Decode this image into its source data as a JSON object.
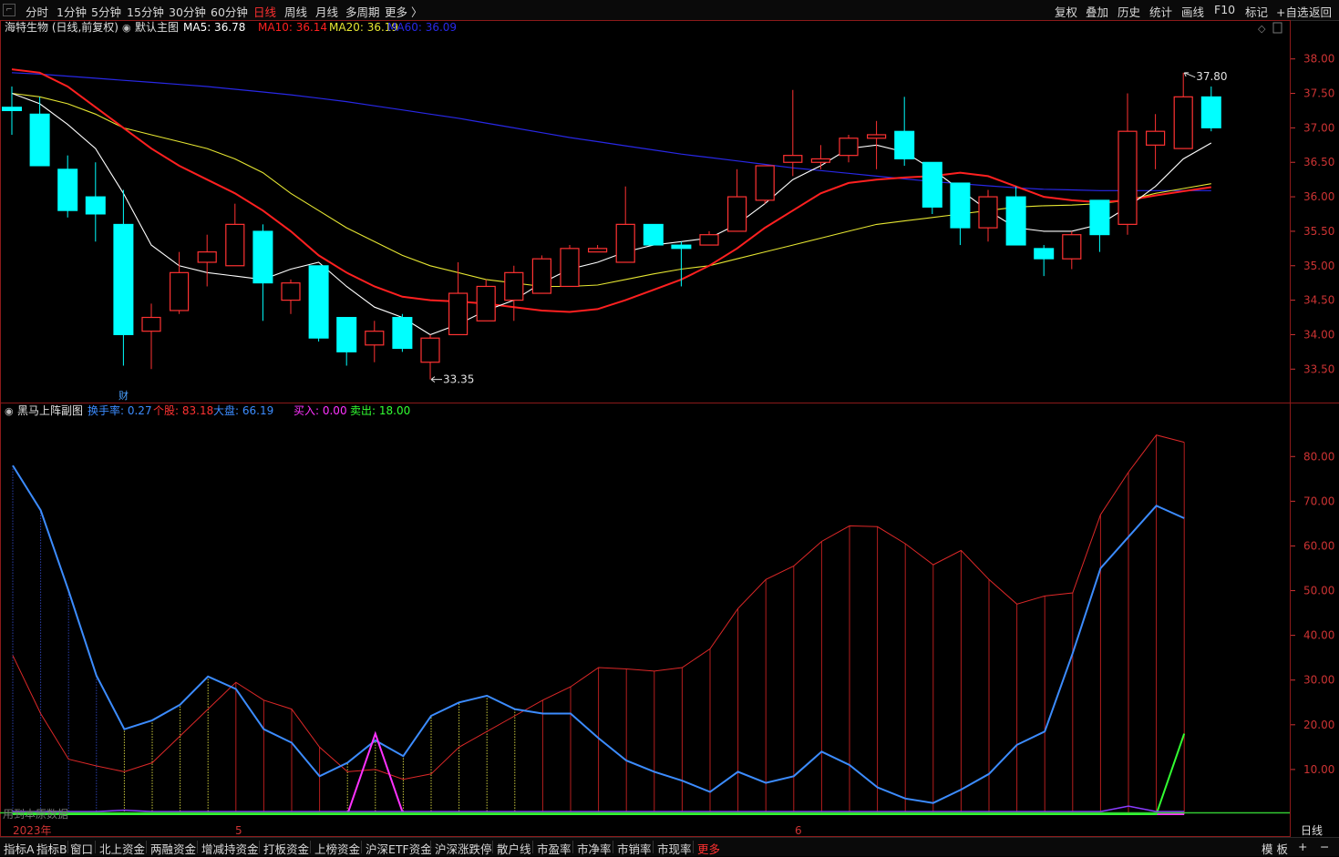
{
  "toolbar": {
    "period_tabs": [
      "分时",
      "1分钟",
      "5分钟",
      "15分钟",
      "30分钟",
      "60分钟",
      "日线",
      "周线",
      "月线",
      "多周期",
      "更多 〉"
    ],
    "active_tab": "日线",
    "right_buttons": [
      "复权",
      "叠加",
      "历史",
      "统计",
      "画线",
      "F10",
      "标记",
      "+自选",
      "返回"
    ]
  },
  "main_chart": {
    "stock_title": "海特生物 (日线,前复权)",
    "indicator_label": "默认主图",
    "ma_legend": [
      {
        "label": "MA5: 36.78",
        "color": "#ffffff"
      },
      {
        "label": "MA10: 36.14",
        "color": "#ff2020"
      },
      {
        "label": "MA20: 36.19",
        "color": "#e6e632"
      },
      {
        "label": "MA60: 36.09",
        "color": "#2828e6"
      }
    ],
    "y_ticks": [
      "38.00",
      "37.50",
      "37.00",
      "36.50",
      "36.00",
      "35.50",
      "35.00",
      "34.50",
      "34.00",
      "33.50"
    ],
    "high_label": "37.80",
    "low_label": "33.35",
    "finance_marker": "财",
    "colors": {
      "up": "#ff3232",
      "down": "#00ffff",
      "ma5": "#ffffff",
      "ma10": "#ff2020",
      "ma20": "#e6e632",
      "ma60": "#2828e6"
    }
  },
  "sub_chart": {
    "title": "黑马上阵副图",
    "legend": [
      {
        "label": "换手率: 0.27",
        "color": "#3c8cff"
      },
      {
        "label": "个股: 83.18",
        "color": "#ff3232"
      },
      {
        "label": "大盘: 66.19",
        "color": "#3c8cff"
      },
      {
        "label": "买入: 0.00",
        "color": "#ff32ff"
      },
      {
        "label": "卖出: 18.00",
        "color": "#32ff32"
      }
    ],
    "y_ticks": [
      "80.00",
      "70.00",
      "60.00",
      "50.00",
      "40.00",
      "30.00",
      "20.00",
      "10.00"
    ],
    "watermark": "用到本原数据"
  },
  "x_axis": {
    "labels": [
      "2023年",
      "5",
      "6"
    ],
    "period_label": "日线"
  },
  "bottom_tabs": [
    "指标A",
    "指标B",
    "窗口",
    "北上资金",
    "两融资金",
    "增减持资金",
    "打板资金",
    "上榜资金",
    "沪深ETF资金",
    "沪深涨跌停",
    "散户线",
    "市盈率",
    "市净率",
    "市销率",
    "市现率",
    "更多"
  ],
  "bottom_right": [
    "模 板",
    "+",
    "−"
  ],
  "chart_data": {
    "type": "candlestick",
    "candles": [
      {
        "o": 37.3,
        "c": 37.25,
        "h": 37.6,
        "l": 36.9
      },
      {
        "o": 37.2,
        "c": 36.45,
        "h": 37.45,
        "l": 36.45
      },
      {
        "o": 36.4,
        "c": 35.8,
        "h": 36.6,
        "l": 35.7
      },
      {
        "o": 36.0,
        "c": 35.75,
        "h": 36.5,
        "l": 35.35
      },
      {
        "o": 35.6,
        "c": 34.0,
        "h": 36.1,
        "l": 33.55
      },
      {
        "o": 34.05,
        "c": 34.25,
        "h": 34.45,
        "l": 33.5
      },
      {
        "o": 34.35,
        "c": 34.9,
        "h": 35.2,
        "l": 34.3
      },
      {
        "o": 35.05,
        "c": 35.2,
        "h": 35.45,
        "l": 34.7
      },
      {
        "o": 35.0,
        "c": 35.6,
        "h": 35.9,
        "l": 35.0
      },
      {
        "o": 35.5,
        "c": 34.75,
        "h": 35.6,
        "l": 34.2
      },
      {
        "o": 34.5,
        "c": 34.75,
        "h": 34.8,
        "l": 34.3
      },
      {
        "o": 35.0,
        "c": 33.95,
        "h": 35.0,
        "l": 33.9
      },
      {
        "o": 34.25,
        "c": 33.75,
        "h": 34.25,
        "l": 33.55
      },
      {
        "o": 33.85,
        "c": 34.05,
        "h": 34.2,
        "l": 33.6
      },
      {
        "o": 34.25,
        "c": 33.8,
        "h": 34.3,
        "l": 33.75
      },
      {
        "o": 33.6,
        "c": 33.95,
        "h": 34.0,
        "l": 33.35
      },
      {
        "o": 34.0,
        "c": 34.6,
        "h": 35.05,
        "l": 34.0
      },
      {
        "o": 34.2,
        "c": 34.7,
        "h": 34.8,
        "l": 34.2
      },
      {
        "o": 34.5,
        "c": 34.9,
        "h": 35.0,
        "l": 34.2
      },
      {
        "o": 34.6,
        "c": 35.1,
        "h": 35.15,
        "l": 34.6
      },
      {
        "o": 34.7,
        "c": 35.25,
        "h": 35.3,
        "l": 34.7
      },
      {
        "o": 35.2,
        "c": 35.25,
        "h": 35.3,
        "l": 35.2
      },
      {
        "o": 35.05,
        "c": 35.6,
        "h": 36.15,
        "l": 35.05
      },
      {
        "o": 35.6,
        "c": 35.3,
        "h": 35.6,
        "l": 35.3
      },
      {
        "o": 35.3,
        "c": 35.25,
        "h": 35.35,
        "l": 34.7
      },
      {
        "o": 35.3,
        "c": 35.45,
        "h": 35.5,
        "l": 35.3
      },
      {
        "o": 35.5,
        "c": 36.0,
        "h": 36.4,
        "l": 35.5
      },
      {
        "o": 35.95,
        "c": 36.45,
        "h": 36.45,
        "l": 35.9
      },
      {
        "o": 36.5,
        "c": 36.6,
        "h": 37.55,
        "l": 36.3
      },
      {
        "o": 36.5,
        "c": 36.55,
        "h": 36.75,
        "l": 36.4
      },
      {
        "o": 36.6,
        "c": 36.85,
        "h": 36.9,
        "l": 36.5
      },
      {
        "o": 36.85,
        "c": 36.9,
        "h": 37.1,
        "l": 36.4
      },
      {
        "o": 36.95,
        "c": 36.55,
        "h": 37.45,
        "l": 36.45
      },
      {
        "o": 36.5,
        "c": 35.85,
        "h": 36.5,
        "l": 35.75
      },
      {
        "o": 36.2,
        "c": 35.55,
        "h": 36.2,
        "l": 35.3
      },
      {
        "o": 35.55,
        "c": 36.0,
        "h": 36.1,
        "l": 35.35
      },
      {
        "o": 36.0,
        "c": 35.3,
        "h": 36.15,
        "l": 35.3
      },
      {
        "o": 35.25,
        "c": 35.1,
        "h": 35.3,
        "l": 34.85
      },
      {
        "o": 35.1,
        "c": 35.45,
        "h": 35.5,
        "l": 34.95
      },
      {
        "o": 35.95,
        "c": 35.45,
        "h": 35.95,
        "l": 35.2
      },
      {
        "o": 35.6,
        "c": 36.95,
        "h": 37.5,
        "l": 35.45
      },
      {
        "o": 36.75,
        "c": 36.95,
        "h": 37.2,
        "l": 36.4
      },
      {
        "o": 36.7,
        "c": 37.45,
        "h": 37.8,
        "l": 36.7
      },
      {
        "o": 37.45,
        "c": 37.0,
        "h": 37.6,
        "l": 36.95
      }
    ],
    "ma5": [
      37.5,
      37.35,
      37.05,
      36.7,
      36.05,
      35.3,
      35.0,
      34.9,
      34.85,
      34.8,
      34.95,
      35.05,
      34.7,
      34.4,
      34.25,
      34.0,
      34.15,
      34.35,
      34.5,
      34.75,
      34.95,
      35.05,
      35.2,
      35.3,
      35.35,
      35.4,
      35.6,
      35.9,
      36.25,
      36.45,
      36.7,
      36.75,
      36.65,
      36.4,
      36.1,
      35.8,
      35.55,
      35.5,
      35.5,
      35.6,
      35.85,
      36.15,
      36.55,
      36.78
    ],
    "ma10": [
      37.85,
      37.8,
      37.6,
      37.3,
      37.0,
      36.7,
      36.45,
      36.25,
      36.05,
      35.8,
      35.5,
      35.15,
      34.9,
      34.7,
      34.55,
      34.5,
      34.48,
      34.45,
      34.4,
      34.35,
      34.33,
      34.37,
      34.5,
      34.65,
      34.8,
      35.0,
      35.25,
      35.55,
      35.8,
      36.05,
      36.2,
      36.25,
      36.28,
      36.3,
      36.35,
      36.3,
      36.15,
      36.0,
      35.95,
      35.92,
      35.95,
      36.02,
      36.08,
      36.14
    ],
    "ma20": [
      37.5,
      37.45,
      37.35,
      37.2,
      37.0,
      36.9,
      36.8,
      36.7,
      36.55,
      36.35,
      36.05,
      35.8,
      35.55,
      35.35,
      35.15,
      35.0,
      34.9,
      34.8,
      34.75,
      34.7,
      34.7,
      34.72,
      34.8,
      34.88,
      34.95,
      35.0,
      35.1,
      35.2,
      35.3,
      35.4,
      35.5,
      35.6,
      35.65,
      35.7,
      35.75,
      35.8,
      35.85,
      35.87,
      35.88,
      35.9,
      35.95,
      36.05,
      36.12,
      36.19
    ],
    "ma60": [
      37.8,
      37.78,
      37.75,
      37.72,
      37.69,
      37.66,
      37.63,
      37.6,
      37.56,
      37.52,
      37.48,
      37.43,
      37.38,
      37.32,
      37.26,
      37.2,
      37.14,
      37.07,
      37.0,
      36.93,
      36.86,
      36.8,
      36.74,
      36.68,
      36.62,
      36.57,
      36.52,
      36.47,
      36.42,
      36.38,
      36.34,
      36.3,
      36.26,
      36.22,
      36.19,
      36.16,
      36.13,
      36.11,
      36.1,
      36.09,
      36.09,
      36.09,
      36.09,
      36.09
    ],
    "stock_line": [
      35.5,
      22.5,
      12.3,
      10.8,
      9.5,
      11.5,
      17.5,
      23.5,
      29.5,
      25.5,
      23.5,
      15.0,
      9.5,
      10.0,
      7.8,
      9.0,
      15.0,
      18.5,
      22.0,
      25.5,
      28.5,
      32.8,
      32.5,
      32.0,
      32.8,
      37.0,
      46.0,
      52.5,
      55.5,
      61.0,
      64.5,
      64.3,
      60.5,
      55.8,
      59.0,
      52.5,
      47.0,
      48.8,
      49.5,
      67.0,
      76.5,
      84.8,
      83.2
    ],
    "market_line": [
      78.0,
      68.0,
      50.0,
      31.0,
      19.0,
      21.0,
      24.5,
      30.8,
      28.0,
      19.0,
      16.0,
      8.5,
      11.5,
      16.5,
      13.0,
      22.0,
      25.0,
      26.5,
      23.5,
      22.5,
      22.5,
      17.0,
      12.0,
      9.5,
      7.5,
      5.0,
      9.5,
      7.0,
      8.5,
      14.0,
      11.0,
      6.0,
      3.5,
      2.5,
      5.5,
      9.0,
      15.5,
      18.5,
      36.0,
      55.0,
      62.0,
      69.0,
      66.2
    ],
    "buy_line": [
      0,
      0,
      0,
      0,
      0,
      0,
      0,
      0,
      0,
      0,
      0,
      0,
      0,
      18,
      0,
      0,
      0,
      0,
      0,
      0,
      0,
      0,
      0,
      0,
      0,
      0,
      0,
      0,
      0,
      0,
      0,
      0,
      0,
      0,
      0,
      0,
      0,
      0,
      0,
      0,
      0,
      0,
      0
    ],
    "sell_line": [
      0,
      0,
      0,
      0,
      0,
      0,
      0,
      0,
      0,
      0,
      0,
      0,
      0,
      0,
      0,
      0,
      0,
      0,
      0,
      0,
      0,
      0,
      0,
      0,
      0,
      0,
      0,
      0,
      0,
      0,
      0,
      0,
      0,
      0,
      0,
      0,
      0,
      0,
      0,
      0,
      0,
      0,
      18
    ],
    "turnover_line": [
      0.6,
      0.6,
      0.6,
      0.6,
      0.9,
      0.6,
      0.6,
      0.6,
      0.6,
      0.6,
      0.6,
      0.6,
      0.6,
      0.6,
      0.6,
      0.6,
      0.6,
      0.6,
      0.6,
      0.6,
      0.6,
      0.6,
      0.6,
      0.6,
      0.6,
      0.6,
      0.6,
      0.6,
      0.6,
      0.6,
      0.6,
      0.6,
      0.6,
      0.6,
      0.6,
      0.6,
      0.6,
      0.6,
      0.6,
      0.6,
      1.8,
      0.6,
      0.6,
      0.27
    ],
    "main_ylim": [
      33.2,
      38.3
    ],
    "sub_ylim": [
      0,
      88
    ]
  }
}
